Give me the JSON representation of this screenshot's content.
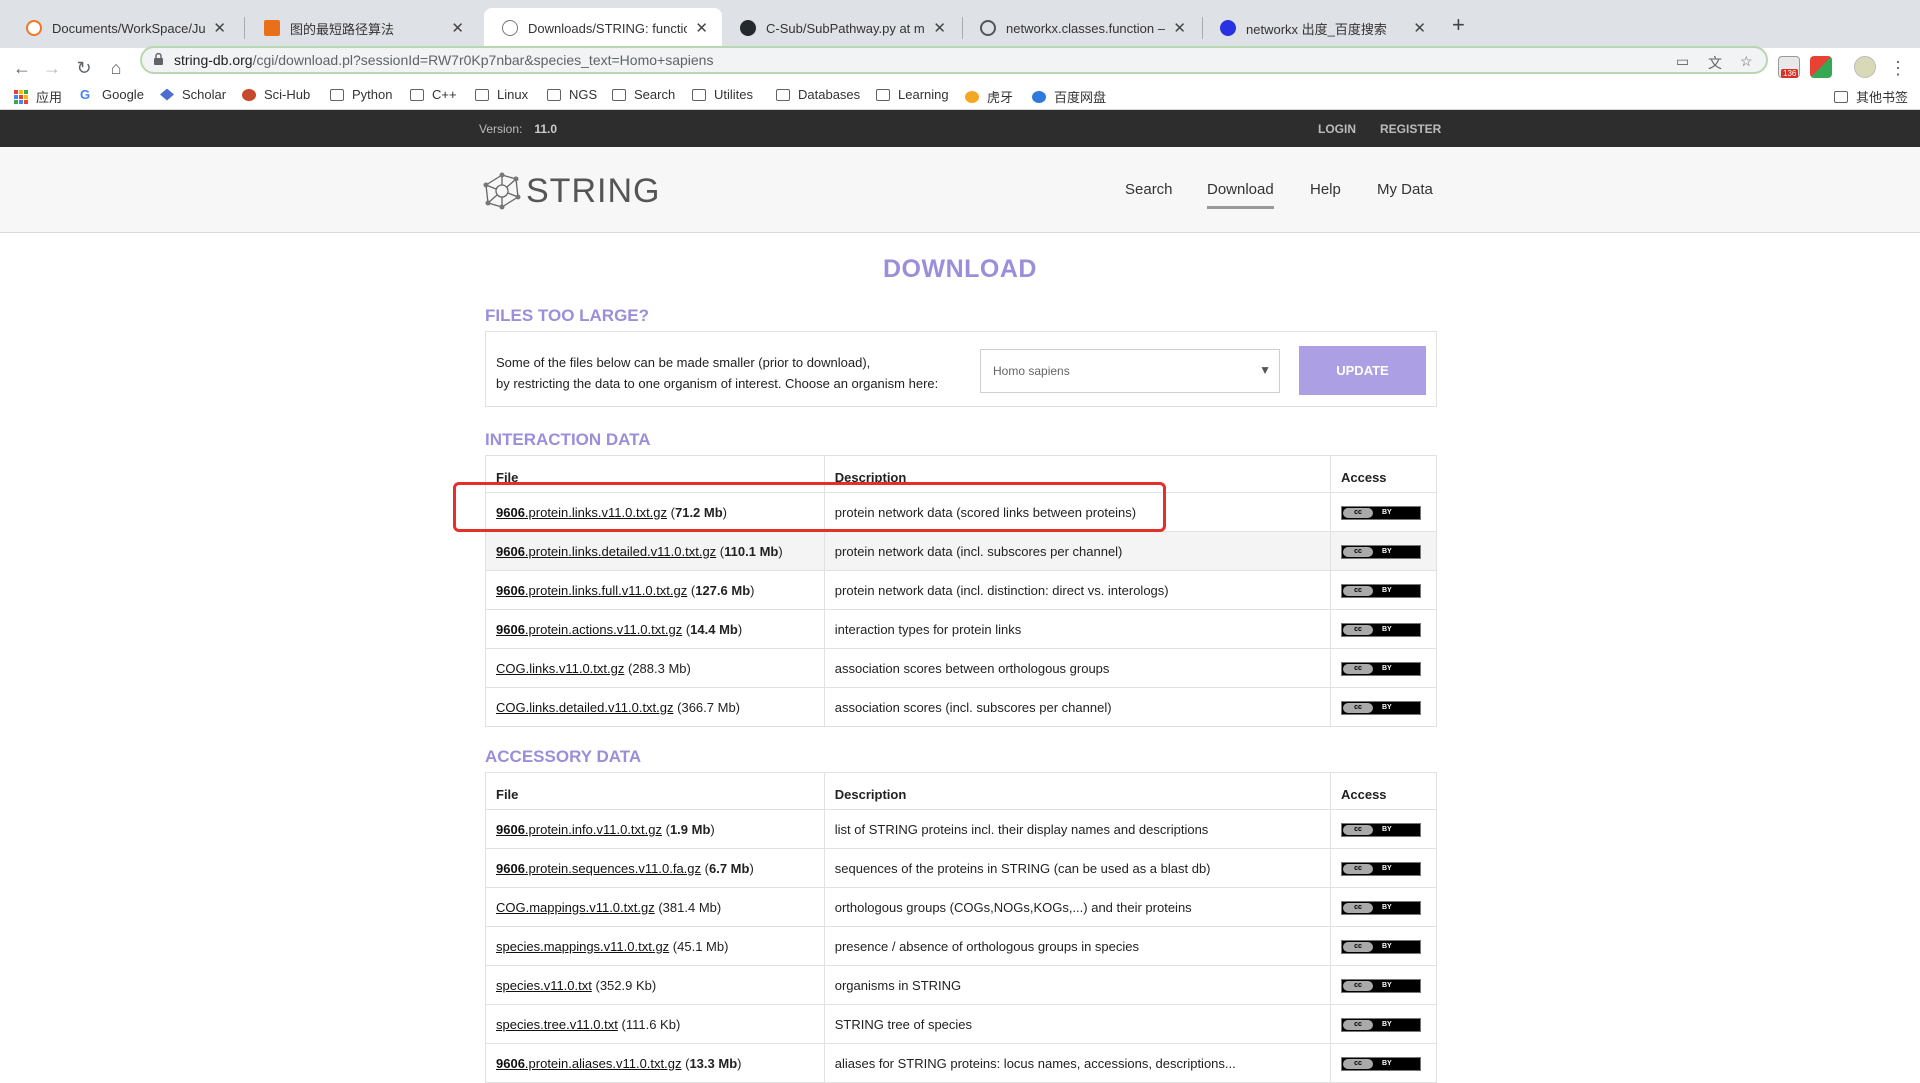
{
  "browser": {
    "tabs": [
      {
        "title": "Documents/WorkSpace/Jupyte",
        "favicon_color": "#f37626",
        "active": false
      },
      {
        "title": "图的最短路径算法",
        "favicon_color": "#ea6f1a",
        "active": false
      },
      {
        "title": "Downloads/STRING: functional",
        "favicon_color": "#888888",
        "active": true
      },
      {
        "title": "C-Sub/SubPathway.py at mast",
        "favicon_color": "#24292e",
        "active": false
      },
      {
        "title": "networkx.classes.function — N",
        "favicon_color": "#555555",
        "active": false
      },
      {
        "title": "networkx 出度_百度搜索",
        "favicon_color": "#2932e1",
        "active": false
      }
    ],
    "url_host": "string-db.org",
    "url_path": "/cgi/download.pl?sessionId=RW7r0Kp7nbar&species_text=Homo+sapiens",
    "mail_badge": "136",
    "bookmarks": [
      {
        "label": "应用",
        "icon": "apps-grid-icon"
      },
      {
        "label": "Google",
        "icon": "google-icon"
      },
      {
        "label": "Scholar",
        "icon": "scholar-icon"
      },
      {
        "label": "Sci-Hub",
        "icon": "scihub-icon"
      },
      {
        "label": "Python",
        "icon": "folder-icon"
      },
      {
        "label": "C++",
        "icon": "folder-icon"
      },
      {
        "label": "Linux",
        "icon": "folder-icon"
      },
      {
        "label": "NGS",
        "icon": "folder-icon"
      },
      {
        "label": "Search",
        "icon": "folder-icon"
      },
      {
        "label": "Utilites",
        "icon": "folder-icon"
      },
      {
        "label": "Databases",
        "icon": "folder-icon"
      },
      {
        "label": "Learning",
        "icon": "folder-icon"
      },
      {
        "label": "虎牙",
        "icon": "huya-icon"
      },
      {
        "label": "百度网盘",
        "icon": "baidupan-icon"
      }
    ],
    "other_bookmarks": "其他书签"
  },
  "site": {
    "version_label": "Version:",
    "version": "11.0",
    "login": "LOGIN",
    "register": "REGISTER",
    "logo_text": "STRING",
    "nav": [
      "Search",
      "Download",
      "Help",
      "My Data"
    ],
    "nav_active": "Download",
    "accent": "#9b8fd9"
  },
  "page": {
    "title": "DOWNLOAD",
    "files_too_large": {
      "heading": "FILES TOO LARGE?",
      "line1": "Some of the files below can be made smaller (prior to download),",
      "line2": "by restricting the data to one organism of interest. Choose an organism here:",
      "organism": "Homo sapiens",
      "update_button": "UPDATE"
    },
    "interaction": {
      "heading": "INTERACTION DATA",
      "headers": [
        "File",
        "Description",
        "Access"
      ],
      "rows": [
        {
          "prefix": "9606",
          "name": ".protein.links.v11.0.txt.gz",
          "size": "71.2 Mb",
          "bold_size": true,
          "desc": "protein network data (scored links between proteins)"
        },
        {
          "prefix": "9606",
          "name": ".protein.links.detailed.v11.0.txt.gz",
          "size": "110.1 Mb",
          "bold_size": true,
          "desc": "protein network data (incl. subscores per channel)"
        },
        {
          "prefix": "9606",
          "name": ".protein.links.full.v11.0.txt.gz",
          "size": "127.6 Mb",
          "bold_size": true,
          "desc": "protein network data (incl. distinction: direct vs. interologs)"
        },
        {
          "prefix": "9606",
          "name": ".protein.actions.v11.0.txt.gz",
          "size": "14.4 Mb",
          "bold_size": true,
          "desc": "interaction types for protein links"
        },
        {
          "prefix": "",
          "name": "COG.links.v11.0.txt.gz",
          "size": "288.3 Mb",
          "bold_size": false,
          "desc": "association scores between orthologous groups"
        },
        {
          "prefix": "",
          "name": "COG.links.detailed.v11.0.txt.gz",
          "size": "366.7 Mb",
          "bold_size": false,
          "desc": "association scores (incl. subscores per channel)"
        }
      ]
    },
    "accessory": {
      "heading": "ACCESSORY DATA",
      "headers": [
        "File",
        "Description",
        "Access"
      ],
      "rows": [
        {
          "prefix": "9606",
          "name": ".protein.info.v11.0.txt.gz",
          "size": "1.9 Mb",
          "bold_size": true,
          "desc": "list of STRING proteins incl. their display names and descriptions"
        },
        {
          "prefix": "9606",
          "name": ".protein.sequences.v11.0.fa.gz",
          "size": "6.7 Mb",
          "bold_size": true,
          "desc": "sequences of the proteins in STRING (can be used as a blast db)"
        },
        {
          "prefix": "",
          "name": "COG.mappings.v11.0.txt.gz",
          "size": "381.4 Mb",
          "bold_size": false,
          "desc": "orthologous groups (COGs,NOGs,KOGs,...) and their proteins"
        },
        {
          "prefix": "",
          "name": "species.mappings.v11.0.txt.gz",
          "size": "45.1 Mb",
          "bold_size": false,
          "desc": "presence / absence of orthologous groups in species"
        },
        {
          "prefix": "",
          "name": "species.v11.0.txt",
          "size": "352.9 Kb",
          "bold_size": false,
          "desc": "organisms in STRING"
        },
        {
          "prefix": "",
          "name": "species.tree.v11.0.txt",
          "size": "111.6 Kb",
          "bold_size": false,
          "desc": "STRING tree of species"
        },
        {
          "prefix": "9606",
          "name": ".protein.aliases.v11.0.txt.gz",
          "size": "13.3 Mb",
          "bold_size": true,
          "desc": "aliases for STRING proteins: locus names, accessions, descriptions..."
        }
      ]
    },
    "license_badge": {
      "left": "cc",
      "right": "BY"
    }
  }
}
